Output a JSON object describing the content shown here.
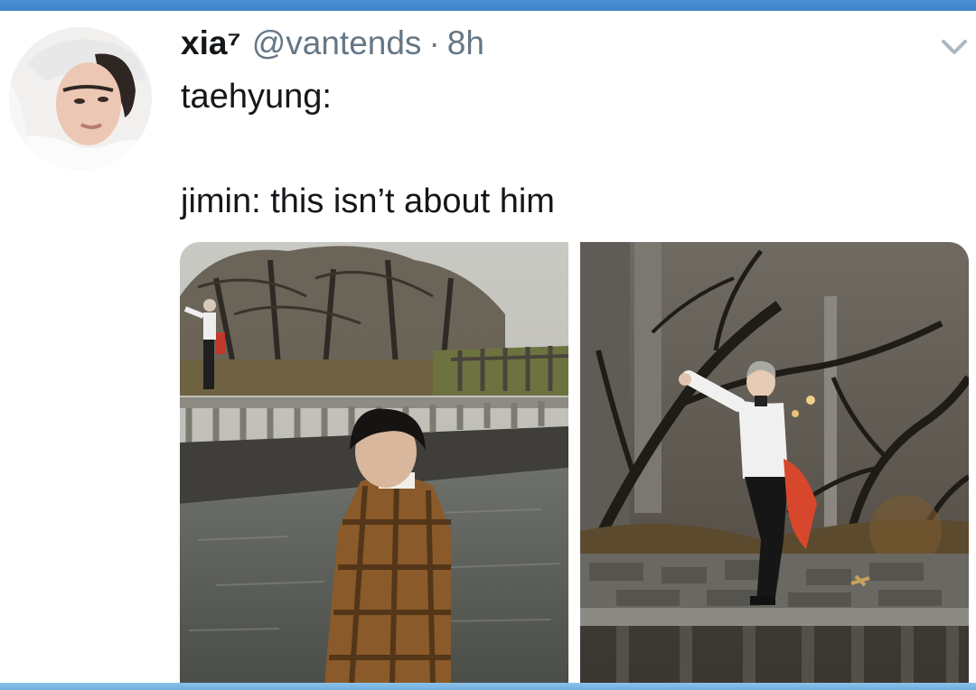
{
  "tweet": {
    "display_name": "xia⁷",
    "handle": "@vantends",
    "separator": "·",
    "time": "8h",
    "text_line1": "taehyung:",
    "text_line2": "jimin: this isn’t about him"
  },
  "icons": {
    "avatar": "profile-avatar",
    "menu": "chevron-down-icon"
  },
  "colors": {
    "header_bar": "#3d84c9",
    "secondary_text": "#657786",
    "primary_text": "#14171a",
    "chevron": "#aab8c2"
  }
}
